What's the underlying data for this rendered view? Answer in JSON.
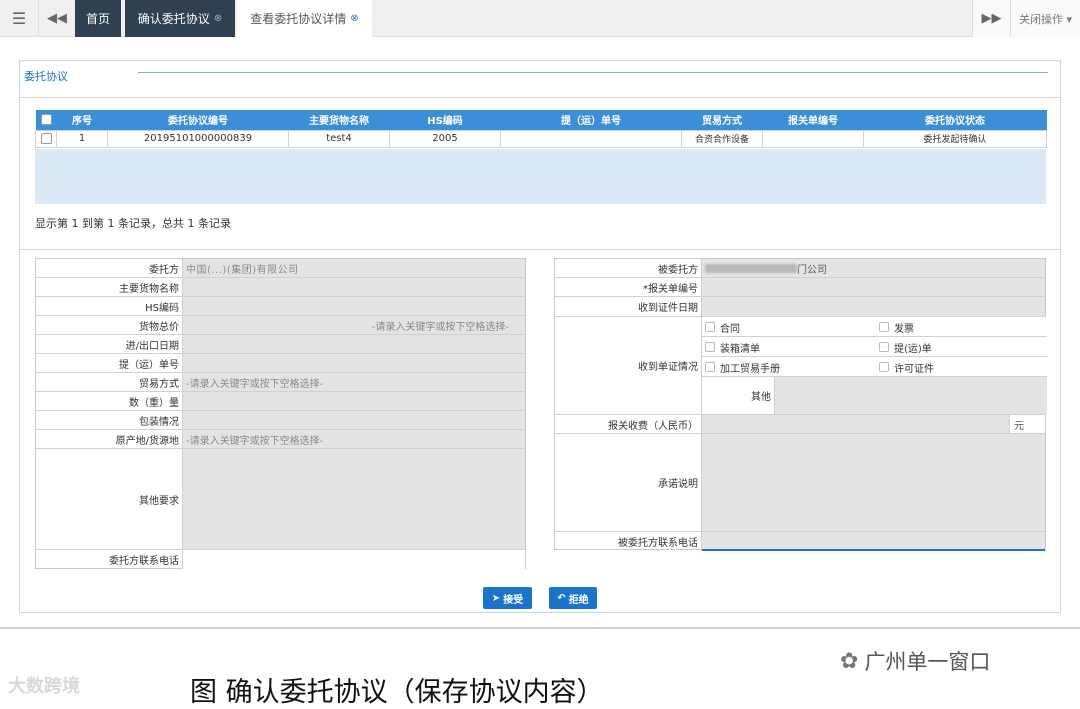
{
  "topbar": {
    "menu_icon": "☰",
    "back_icon": "◀◀",
    "tabs": [
      {
        "label": "首页"
      },
      {
        "label": "确认委托协议",
        "close_icon": "⊗"
      },
      {
        "label": "查看委托协议详情",
        "close_icon": "⊗"
      }
    ],
    "forward_icon": "▶▶",
    "close_ops_label": "关闭操作 ▾"
  },
  "panel": {
    "title": "委托协议",
    "table": {
      "headers": [
        "序号",
        "委托协议编号",
        "主要货物名称",
        "HS编码",
        "提（运）单号",
        "贸易方式",
        "报关单编号",
        "委托协议状态"
      ],
      "rows": [
        {
          "index": "1",
          "agreement_no": "20195101000000839",
          "goods_name": "test4",
          "hs_code": "2005",
          "bill_no": "",
          "trade_mode": "合资合作设备",
          "declaration_no": "",
          "status": "委托发起待确认"
        }
      ],
      "info": "显示第 1 到第 1 条记录，总共 1 条记录"
    },
    "left_form": {
      "principal_label": "委托方",
      "principal_value": "中国(...)(集团)有限公司",
      "goods_label": "主要货物名称",
      "hs_label": "HS编码",
      "total_price_label": "货物总价",
      "total_price_placeholder": "-请录入关键字或按下空格选择-",
      "date_label": "进/出口日期",
      "bill_label": "提（运）单号",
      "trade_label": "贸易方式",
      "trade_placeholder": "-请录入关键字或按下空格选择-",
      "quantity_label": "数（重）量",
      "packing_label": "包装情况",
      "origin_label": "原产地/货源地",
      "origin_placeholder": "-请录入关键字或按下空格选择-",
      "other_req_label": "其他要求",
      "phone_label": "委托方联系电话"
    },
    "right_form": {
      "agent_label": "被委托方",
      "agent_value": "门公司",
      "declaration_label": "*报关单编号",
      "doc_date_label": "收到证件日期",
      "docs_label": "收到单证情况",
      "docs": [
        "合同",
        "发票",
        "装箱清单",
        "提(运)单",
        "加工贸易手册",
        "许可证件"
      ],
      "other_label": "其他",
      "fee_label": "报关收费（人民币）",
      "fee_unit": "元",
      "promise_label": "承诺说明",
      "phone_label": "被委托方联系电话"
    },
    "buttons": {
      "accept_icon": "➤",
      "accept": "接受",
      "reject_icon": "↶",
      "reject": "拒绝"
    }
  },
  "caption": "图  确认委托协议（保存协议内容）",
  "watermark_left": "大数跨境",
  "watermark_right": "广州单一窗口"
}
